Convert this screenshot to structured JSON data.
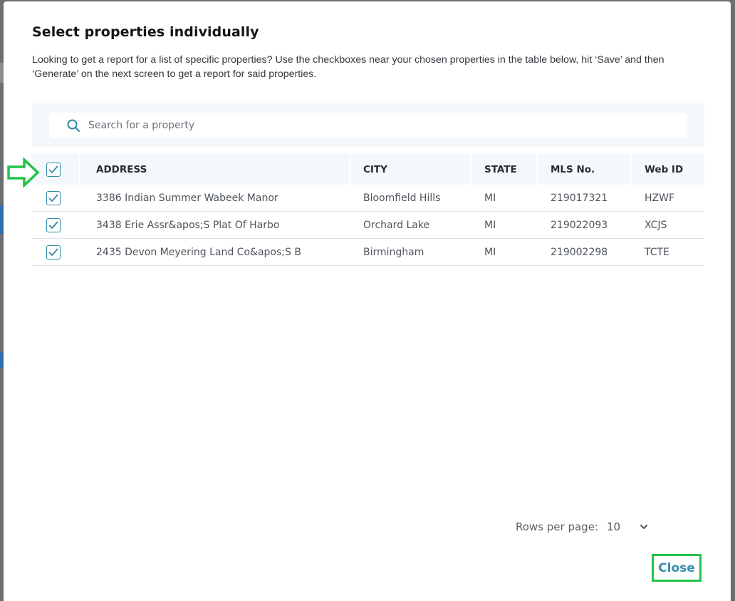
{
  "modal": {
    "title": "Select properties individually",
    "description": "Looking to get a report for a list of specific properties? Use the checkboxes near your chosen properties in the table below, hit ‘Save’ and then ‘Generate’ on the next screen to get a report for said properties."
  },
  "search": {
    "placeholder": "Search for a property",
    "value": ""
  },
  "table": {
    "select_all_checked": true,
    "headers": {
      "address": "ADDRESS",
      "city": "CITY",
      "state": "STATE",
      "mls": "MLS No.",
      "web_id": "Web ID"
    },
    "rows": [
      {
        "checked": true,
        "address": "3386 Indian Summer Wabeek Manor",
        "city": "Bloomfield Hills",
        "state": "MI",
        "mls": "219017321",
        "web_id": "HZWF"
      },
      {
        "checked": true,
        "address": "3438 Erie Assr&apos;S Plat Of Harbo",
        "city": "Orchard Lake",
        "state": "MI",
        "mls": "219022093",
        "web_id": "XCJS"
      },
      {
        "checked": true,
        "address": "2435 Devon Meyering Land Co&apos;S B",
        "city": "Birmingham",
        "state": "MI",
        "mls": "219002298",
        "web_id": "TCTE"
      }
    ]
  },
  "pagination": {
    "rows_per_page_label": "Rows per page:",
    "rows_per_page_value": "10"
  },
  "actions": {
    "close_label": "Close"
  },
  "colors": {
    "accent": "#2e8aa8",
    "highlight": "#22c34a",
    "header_bg": "#f3f8fc"
  },
  "icons": {
    "search": "search-icon",
    "check": "checkmark-icon",
    "chevron": "chevron-down-icon",
    "annotation": "arrow-right-icon"
  }
}
